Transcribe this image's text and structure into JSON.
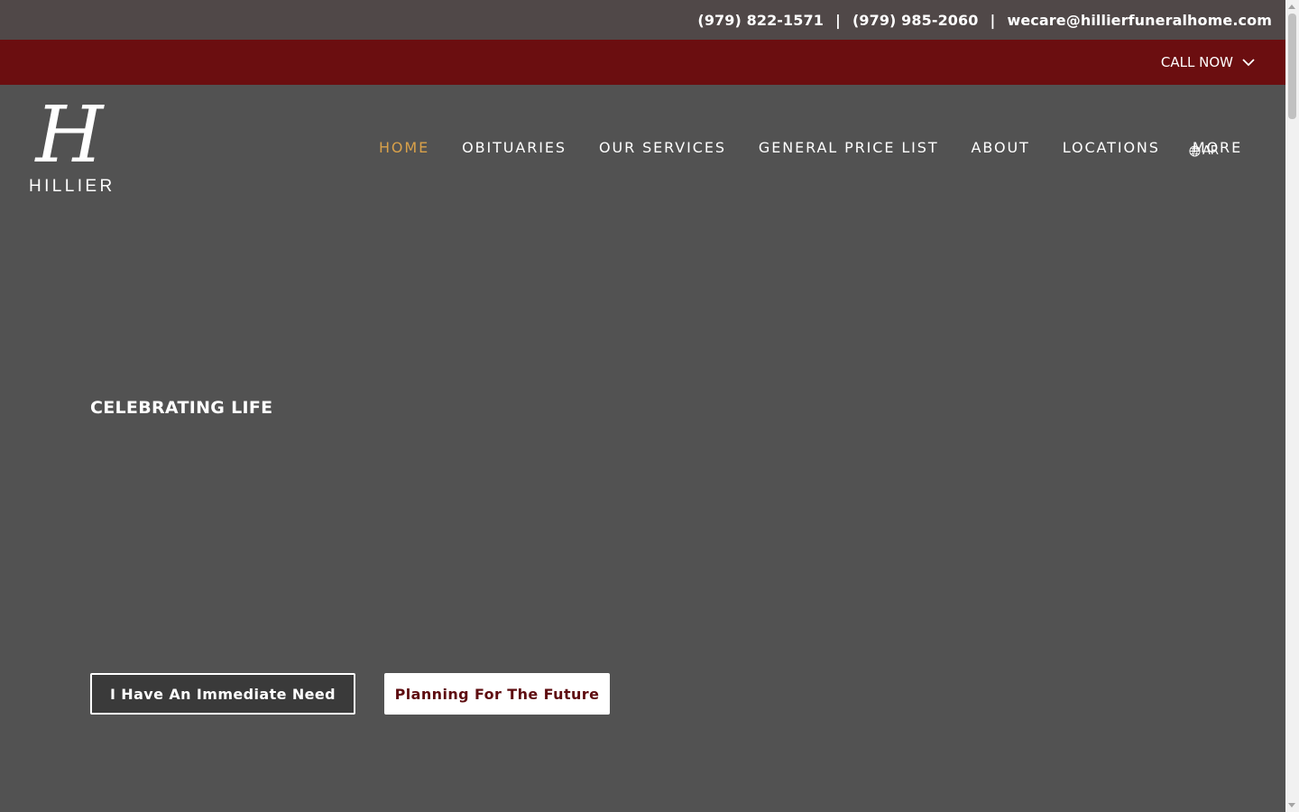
{
  "topbar": {
    "phone1": "(979) 822-1571",
    "phone2": "(979) 985-2060",
    "email": "wecare@hillierfuneralhome.com",
    "separator": "|"
  },
  "callbar": {
    "label": "CALL NOW",
    "icon": "chevron-down-icon"
  },
  "logo": {
    "monogram": "H",
    "name": "HILLIER"
  },
  "nav": {
    "items": [
      {
        "label": "HOME",
        "active": true
      },
      {
        "label": "OBITUARIES"
      },
      {
        "label": "OUR SERVICES"
      },
      {
        "label": "GENERAL PRICE LIST"
      },
      {
        "label": "ABOUT"
      },
      {
        "label": "LOCATIONS"
      },
      {
        "label": "MORE"
      }
    ],
    "active_color": "#d9a14a"
  },
  "language": {
    "code": "AR",
    "icon": "globe-icon"
  },
  "hero": {
    "title": "CELEBRATING LIFE",
    "primary_button": "I Have An Immediate Need",
    "secondary_button": "Planning For The Future"
  },
  "colors": {
    "topbar_bg": "#504848",
    "callbar_bg": "#6b0e10",
    "page_bg": "#525252",
    "button_text_dark": "#5e0c10"
  }
}
